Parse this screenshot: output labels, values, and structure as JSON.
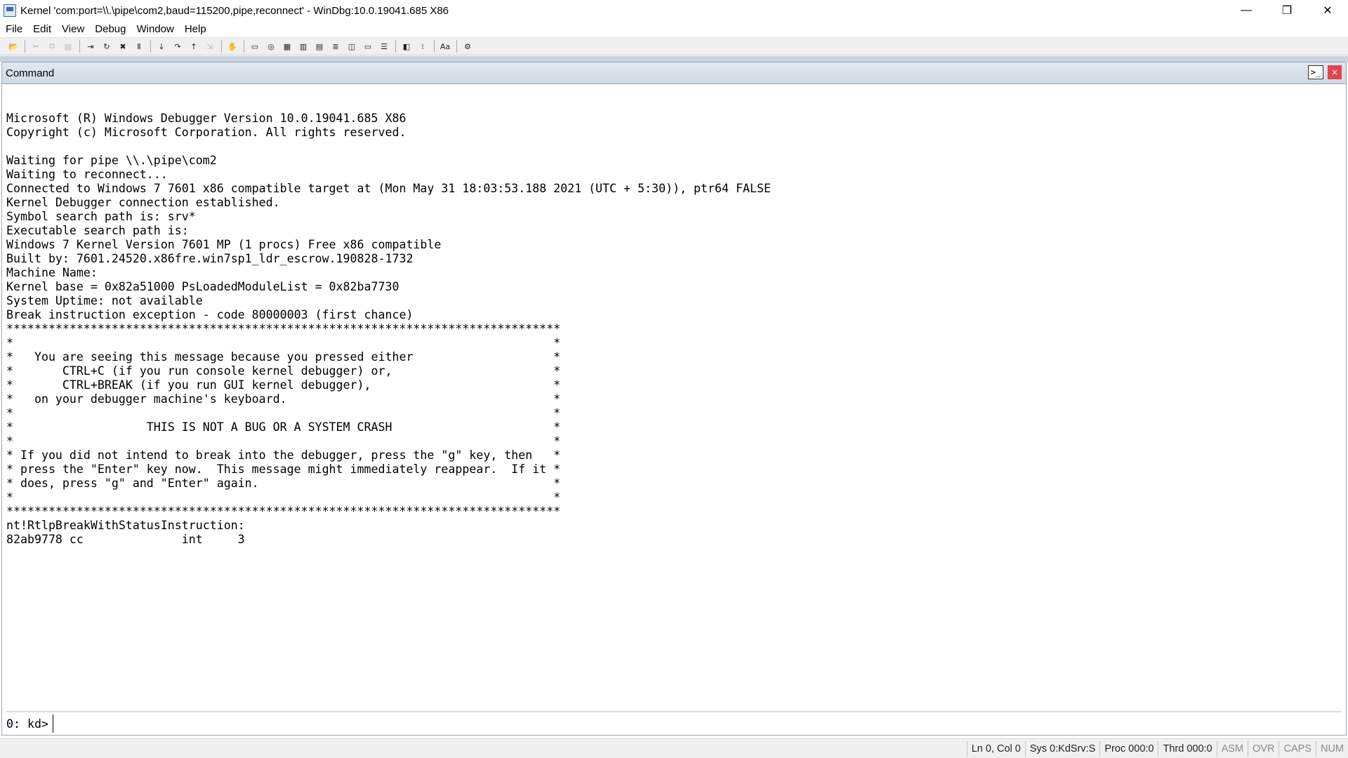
{
  "window": {
    "title": "Kernel 'com:port=\\\\.\\pipe\\com2,baud=115200,pipe,reconnect' - WinDbg:10.0.19041.685 X86",
    "minimize": "—",
    "restore": "❐",
    "close": "✕"
  },
  "menu": {
    "items": [
      "File",
      "Edit",
      "View",
      "Debug",
      "Window",
      "Help"
    ]
  },
  "toolbar": {
    "open": "📂",
    "cut": "✂",
    "copy": "⧉",
    "paste": "▤",
    "go": "⇥",
    "restart": "↻",
    "stop": "✖",
    "break": "Ⅱ",
    "step_into": "↓",
    "step_over": "↷",
    "step_out": "↑",
    "run_to_cursor": "⇲",
    "breakpoint": "✋",
    "command": "▭",
    "watch": "◎",
    "locals": "▦",
    "registers": "▥",
    "memory": "▤",
    "call_stack": "≣",
    "disassembly": "◫",
    "scratch_pad": "▭",
    "processes": "☰",
    "source_mode": "◧",
    "hex": "⁝",
    "font": "Aa",
    "options": "⚙"
  },
  "command_window": {
    "title": "Command",
    "icon": ">_",
    "close": "×",
    "output": "\nMicrosoft (R) Windows Debugger Version 10.0.19041.685 X86\nCopyright (c) Microsoft Corporation. All rights reserved.\n\nWaiting for pipe \\\\.\\pipe\\com2\nWaiting to reconnect...\nConnected to Windows 7 7601 x86 compatible target at (Mon May 31 18:03:53.188 2021 (UTC + 5:30)), ptr64 FALSE\nKernel Debugger connection established.\nSymbol search path is: srv*\nExecutable search path is:\nWindows 7 Kernel Version 7601 MP (1 procs) Free x86 compatible\nBuilt by: 7601.24520.x86fre.win7sp1_ldr_escrow.190828-1732\nMachine Name:\nKernel base = 0x82a51000 PsLoadedModuleList = 0x82ba7730\nSystem Uptime: not available\nBreak instruction exception - code 80000003 (first chance)\n*******************************************************************************\n*                                                                             *\n*   You are seeing this message because you pressed either                    *\n*       CTRL+C (if you run console kernel debugger) or,                       *\n*       CTRL+BREAK (if you run GUI kernel debugger),                          *\n*   on your debugger machine's keyboard.                                      *\n*                                                                             *\n*                   THIS IS NOT A BUG OR A SYSTEM CRASH                       *\n*                                                                             *\n* If you did not intend to break into the debugger, press the \"g\" key, then   *\n* press the \"Enter\" key now.  This message might immediately reappear.  If it *\n* does, press \"g\" and \"Enter\" again.                                          *\n*                                                                             *\n*******************************************************************************\nnt!RtlpBreakWithStatusInstruction:\n82ab9778 cc              int     3",
    "prompt": "0: kd>",
    "input_value": ""
  },
  "statusbar": {
    "position": "Ln 0, Col 0",
    "sys": "Sys 0:KdSrv:S",
    "proc": "Proc 000:0",
    "thrd": "Thrd 000:0",
    "asm": "ASM",
    "ovr": "OVR",
    "caps": "CAPS",
    "num": "NUM"
  }
}
